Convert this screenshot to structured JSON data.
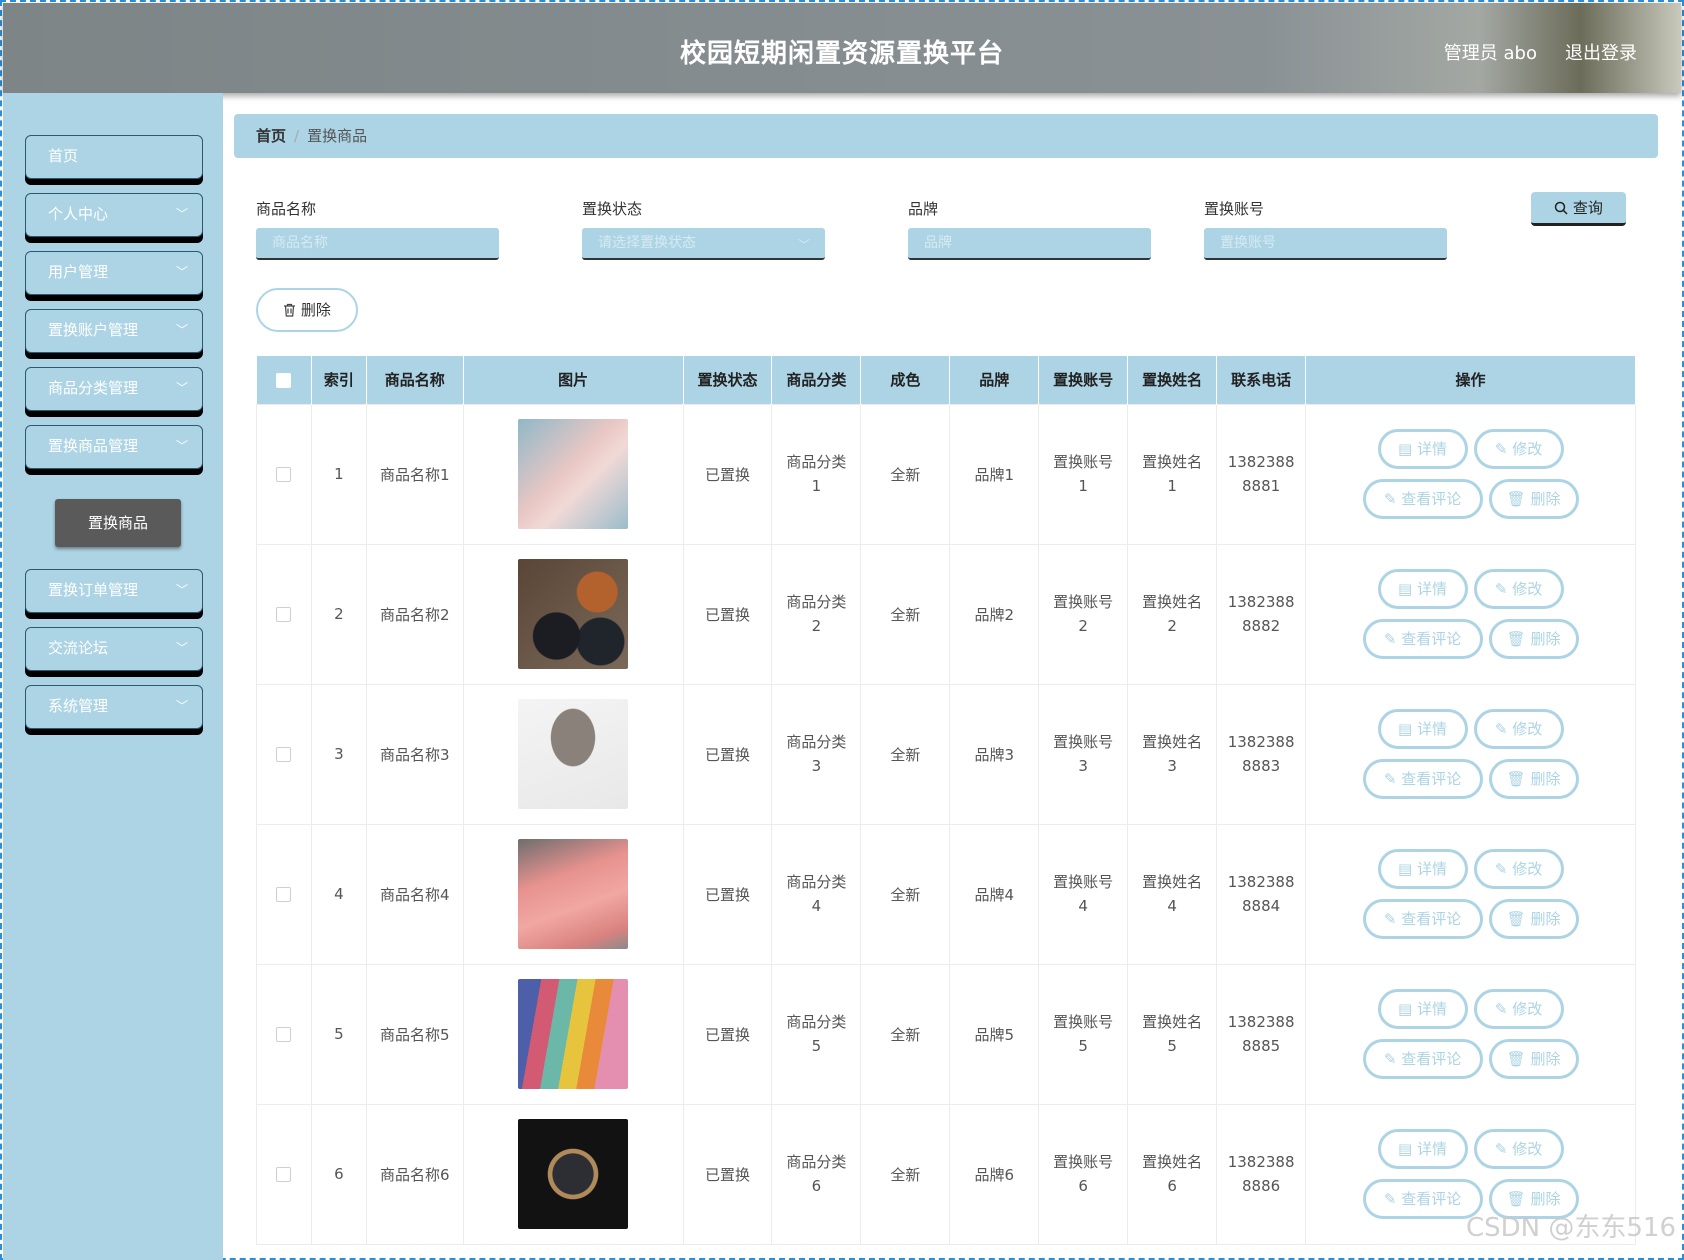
{
  "header": {
    "title": "校园短期闲置资源置换平台",
    "user": "管理员 abo",
    "logout": "退出登录"
  },
  "sidebar": {
    "items": [
      {
        "label": "首页",
        "has_chevron": false
      },
      {
        "label": "个人中心",
        "has_chevron": true
      },
      {
        "label": "用户管理",
        "has_chevron": true
      },
      {
        "label": "置换账户管理",
        "has_chevron": true
      },
      {
        "label": "商品分类管理",
        "has_chevron": true
      },
      {
        "label": "置换商品管理",
        "has_chevron": true
      },
      {
        "label": "置换订单管理",
        "has_chevron": true
      },
      {
        "label": "交流论坛",
        "has_chevron": true
      },
      {
        "label": "系统管理",
        "has_chevron": true
      }
    ],
    "active_sub": "置换商品"
  },
  "breadcrumb": {
    "home": "首页",
    "separator": "/",
    "current": "置换商品"
  },
  "search": {
    "name_label": "商品名称",
    "name_placeholder": "商品名称",
    "status_label": "置换状态",
    "status_placeholder": "请选择置换状态",
    "brand_label": "品牌",
    "brand_placeholder": "品牌",
    "account_label": "置换账号",
    "account_placeholder": "置换账号",
    "query": "查询"
  },
  "toolbar": {
    "delete": "删除"
  },
  "table": {
    "headers": [
      "索引",
      "商品名称",
      "图片",
      "置换状态",
      "商品分类",
      "成色",
      "品牌",
      "置换账号",
      "置换姓名",
      "联系电话",
      "操作"
    ],
    "rows": [
      {
        "index": "1",
        "name": "商品名称1",
        "image": "pink-handbag-photo",
        "status": "已置换",
        "category_a": "商品分类",
        "category_b": "1",
        "condition": "全新",
        "brand": "品牌1",
        "account_a": "置换账号",
        "account_b": "1",
        "person_a": "置换姓名",
        "person_b": "1",
        "phone_a": "1382388",
        "phone_b": "8881"
      },
      {
        "index": "2",
        "name": "商品名称2",
        "image": "leather-shoes-photo",
        "status": "已置换",
        "category_a": "商品分类",
        "category_b": "2",
        "condition": "全新",
        "brand": "品牌2",
        "account_a": "置换账号",
        "account_b": "2",
        "person_a": "置换姓名",
        "person_b": "2",
        "phone_a": "1382388",
        "phone_b": "8882"
      },
      {
        "index": "3",
        "name": "商品名称3",
        "image": "neck-massager-photo",
        "status": "已置换",
        "category_a": "商品分类",
        "category_b": "3",
        "condition": "全新",
        "brand": "品牌3",
        "account_a": "置换账号",
        "account_b": "3",
        "person_a": "置换姓名",
        "person_b": "3",
        "phone_a": "1382388",
        "phone_b": "8883"
      },
      {
        "index": "4",
        "name": "商品名称4",
        "image": "pink-quilt-photo",
        "status": "已置换",
        "category_a": "商品分类",
        "category_b": "4",
        "condition": "全新",
        "brand": "品牌4",
        "account_a": "置换账号",
        "account_b": "4",
        "person_a": "置换姓名",
        "person_b": "4",
        "phone_a": "1382388",
        "phone_b": "8884"
      },
      {
        "index": "5",
        "name": "商品名称5",
        "image": "colorful-wallets-photo",
        "status": "已置换",
        "category_a": "商品分类",
        "category_b": "5",
        "condition": "全新",
        "brand": "品牌5",
        "account_a": "置换账号",
        "account_b": "5",
        "person_a": "置换姓名",
        "person_b": "5",
        "phone_a": "1382388",
        "phone_b": "8885"
      },
      {
        "index": "6",
        "name": "商品名称6",
        "image": "wrist-watch-photo",
        "status": "已置换",
        "category_a": "商品分类",
        "category_b": "6",
        "condition": "全新",
        "brand": "品牌6",
        "account_a": "置换账号",
        "account_b": "6",
        "person_a": "置换姓名",
        "person_b": "6",
        "phone_a": "1382388",
        "phone_b": "8886"
      }
    ],
    "actions": {
      "detail": "详情",
      "edit": "修改",
      "comments": "查看评论",
      "delete": "删除"
    }
  },
  "watermark": "CSDN @东东516",
  "colors": {
    "accent": "#acd4e5",
    "header_bg": "#858c8f",
    "active_sub_bg": "#5a5a5a"
  }
}
